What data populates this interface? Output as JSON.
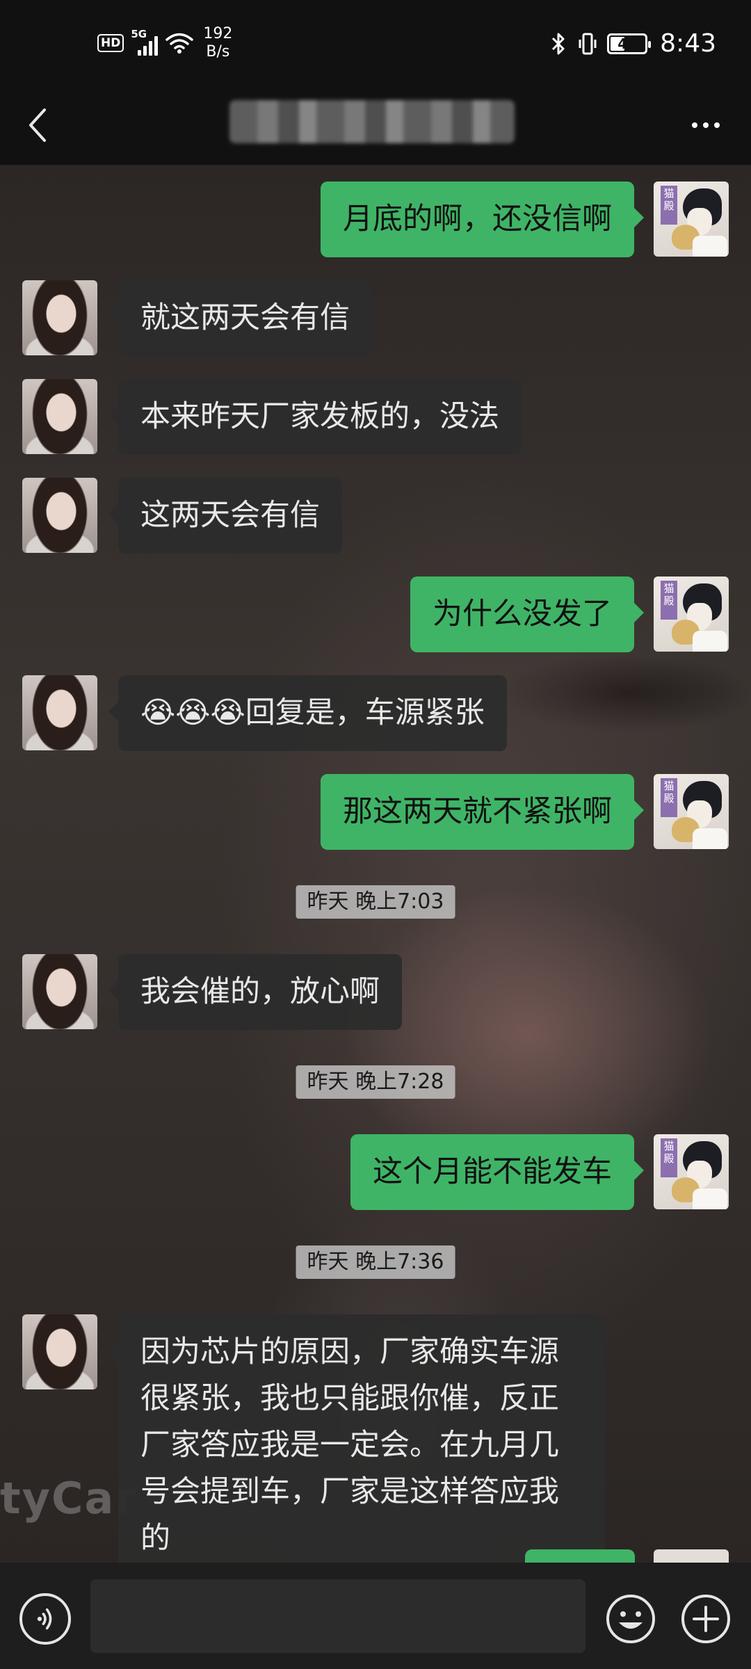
{
  "status_bar": {
    "hd": "HD",
    "network": "5G",
    "speed_value": "192",
    "speed_unit": "B/s",
    "battery_percent": "41",
    "battery_level": 0.41,
    "time": "8:43"
  },
  "header": {
    "title": "",
    "back_icon": "back-chevron-icon",
    "more_icon": "more-dots-icon"
  },
  "messages": [
    {
      "side": "out",
      "text": "月底的啊，还没信啊"
    },
    {
      "side": "in",
      "text": "就这两天会有信"
    },
    {
      "side": "in",
      "text": "本来昨天厂家发板的，没法"
    },
    {
      "side": "in",
      "text": "这两天会有信"
    },
    {
      "side": "out",
      "text": "为什么没发了"
    },
    {
      "side": "in",
      "emoji": "😭😭😭",
      "text": "回复是，车源紧张"
    },
    {
      "side": "out",
      "text": "那这两天就不紧张啊"
    },
    {
      "type": "time",
      "text": "昨天 晚上7:03"
    },
    {
      "side": "in",
      "text": "我会催的，放心啊"
    },
    {
      "type": "time",
      "text": "昨天 晚上7:28"
    },
    {
      "side": "out",
      "text": "这个月能不能发车"
    },
    {
      "type": "time",
      "text": "昨天 晚上7:36"
    },
    {
      "side": "in",
      "text": "因为芯片的原因，厂家确实车源很紧张，我也只能跟你催，反正厂家答应我是一定会。在九月几号会提到车，厂家是这样答应我的"
    }
  ],
  "avatar_me_tag": "猫殿",
  "watermark": "tyCar",
  "input_bar": {
    "placeholder": "",
    "voice_icon": "voice-icon",
    "emoji_icon": "emoji-icon",
    "plus_icon": "plus-icon"
  },
  "colors": {
    "outgoing_bubble": "#3fb466",
    "incoming_bubble": "#2c2c2c",
    "bar_background": "#111111"
  }
}
